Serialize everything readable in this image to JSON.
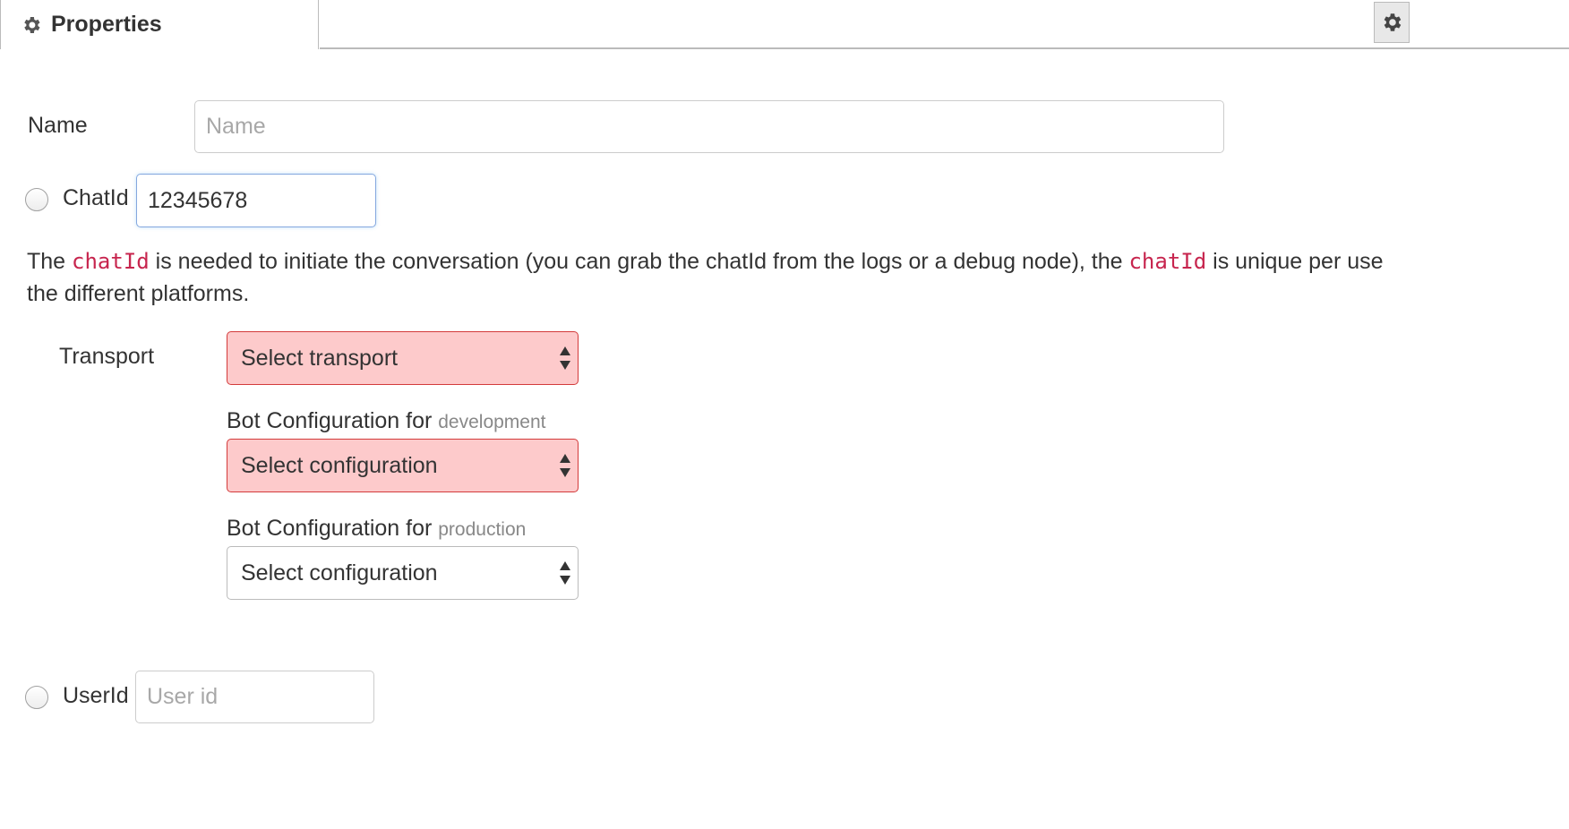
{
  "tab": {
    "label": "Properties",
    "icon": "gear-icon"
  },
  "settings_button": {
    "icon": "gear-icon"
  },
  "name_field": {
    "label": "Name",
    "placeholder": "Name",
    "value": ""
  },
  "chatid_field": {
    "label": "ChatId",
    "value": "12345678",
    "radio_selected": false
  },
  "help": {
    "text_1": "The ",
    "code_1": "chatId",
    "text_2": " is needed to initiate the conversation (you can grab the chatId from the logs or a debug node), the ",
    "code_2": "chatId",
    "text_3": " is unique per use",
    "text_4": "the different platforms."
  },
  "transport": {
    "label": "Transport",
    "selected": "Select transport",
    "error": true
  },
  "bot_config_dev": {
    "label": "Bot Configuration for",
    "env": "development",
    "selected": "Select configuration",
    "error": true
  },
  "bot_config_prod": {
    "label": "Bot Configuration for",
    "env": "production",
    "selected": "Select configuration",
    "error": false
  },
  "userid_field": {
    "label": "UserId",
    "placeholder": "User id",
    "value": "",
    "radio_selected": false
  },
  "colors": {
    "error_bg": "#fdcacb",
    "error_border": "#d33b3b",
    "code": "#c7254e",
    "focus_border": "#85a8df"
  }
}
